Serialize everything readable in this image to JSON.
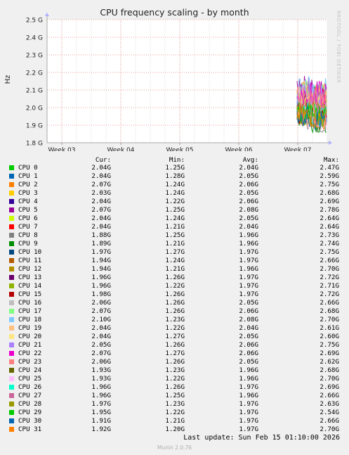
{
  "chart_data": {
    "type": "line",
    "title": "CPU frequency scaling - by month",
    "ylabel": "Hz",
    "ylim": [
      1.8,
      2.5
    ],
    "y_ticks": [
      "1.8 G",
      "1.9 G",
      "2.0 G",
      "2.1 G",
      "2.2 G",
      "2.3 G",
      "2.4 G",
      "2.5 G"
    ],
    "x_ticks": [
      "Week 03",
      "Week 04",
      "Week 05",
      "Week 06",
      "Week 07"
    ],
    "grid": true,
    "watermark": "RRDTOOL / TOBI OETIKER",
    "columns": [
      "Cur:",
      "Min:",
      "Avg:",
      "Max:"
    ],
    "series": [
      {
        "name": "CPU 0",
        "color": "#00cc00",
        "cur": "2.04G",
        "min": "1.25G",
        "avg": "2.04G",
        "max": "2.47G"
      },
      {
        "name": "CPU 1",
        "color": "#0066b3",
        "cur": "2.04G",
        "min": "1.28G",
        "avg": "2.05G",
        "max": "2.59G"
      },
      {
        "name": "CPU 2",
        "color": "#ff8000",
        "cur": "2.07G",
        "min": "1.24G",
        "avg": "2.06G",
        "max": "2.75G"
      },
      {
        "name": "CPU 3",
        "color": "#ffcc00",
        "cur": "2.03G",
        "min": "1.24G",
        "avg": "2.05G",
        "max": "2.68G"
      },
      {
        "name": "CPU 4",
        "color": "#330099",
        "cur": "2.04G",
        "min": "1.22G",
        "avg": "2.06G",
        "max": "2.69G"
      },
      {
        "name": "CPU 5",
        "color": "#990099",
        "cur": "2.07G",
        "min": "1.25G",
        "avg": "2.08G",
        "max": "2.78G"
      },
      {
        "name": "CPU 6",
        "color": "#ccff00",
        "cur": "2.04G",
        "min": "1.24G",
        "avg": "2.05G",
        "max": "2.64G"
      },
      {
        "name": "CPU 7",
        "color": "#ff0000",
        "cur": "2.04G",
        "min": "1.21G",
        "avg": "2.04G",
        "max": "2.64G"
      },
      {
        "name": "CPU 8",
        "color": "#808080",
        "cur": "1.88G",
        "min": "1.25G",
        "avg": "1.96G",
        "max": "2.73G"
      },
      {
        "name": "CPU 9",
        "color": "#008f00",
        "cur": "1.89G",
        "min": "1.21G",
        "avg": "1.96G",
        "max": "2.74G"
      },
      {
        "name": "CPU 10",
        "color": "#00487d",
        "cur": "1.97G",
        "min": "1.27G",
        "avg": "1.97G",
        "max": "2.75G"
      },
      {
        "name": "CPU 11",
        "color": "#b35a00",
        "cur": "1.94G",
        "min": "1.24G",
        "avg": "1.97G",
        "max": "2.66G"
      },
      {
        "name": "CPU 12",
        "color": "#b38f00",
        "cur": "1.94G",
        "min": "1.21G",
        "avg": "1.96G",
        "max": "2.70G"
      },
      {
        "name": "CPU 13",
        "color": "#6b006b",
        "cur": "1.96G",
        "min": "1.26G",
        "avg": "1.97G",
        "max": "2.72G"
      },
      {
        "name": "CPU 14",
        "color": "#8fb300",
        "cur": "1.96G",
        "min": "1.22G",
        "avg": "1.97G",
        "max": "2.71G"
      },
      {
        "name": "CPU 15",
        "color": "#b30000",
        "cur": "1.98G",
        "min": "1.26G",
        "avg": "1.97G",
        "max": "2.72G"
      },
      {
        "name": "CPU 16",
        "color": "#bebebe",
        "cur": "2.06G",
        "min": "1.26G",
        "avg": "2.05G",
        "max": "2.66G"
      },
      {
        "name": "CPU 17",
        "color": "#80ff80",
        "cur": "2.07G",
        "min": "1.26G",
        "avg": "2.06G",
        "max": "2.68G"
      },
      {
        "name": "CPU 18",
        "color": "#80c9ff",
        "cur": "2.10G",
        "min": "1.23G",
        "avg": "2.08G",
        "max": "2.70G"
      },
      {
        "name": "CPU 19",
        "color": "#ffc080",
        "cur": "2.04G",
        "min": "1.22G",
        "avg": "2.04G",
        "max": "2.61G"
      },
      {
        "name": "CPU 20",
        "color": "#ffe680",
        "cur": "2.04G",
        "min": "1.27G",
        "avg": "2.05G",
        "max": "2.60G"
      },
      {
        "name": "CPU 21",
        "color": "#aa80ff",
        "cur": "2.05G",
        "min": "1.26G",
        "avg": "2.06G",
        "max": "2.75G"
      },
      {
        "name": "CPU 22",
        "color": "#ee00cc",
        "cur": "2.07G",
        "min": "1.27G",
        "avg": "2.06G",
        "max": "2.69G"
      },
      {
        "name": "CPU 23",
        "color": "#ff8080",
        "cur": "2.06G",
        "min": "1.26G",
        "avg": "2.05G",
        "max": "2.62G"
      },
      {
        "name": "CPU 24",
        "color": "#666600",
        "cur": "1.93G",
        "min": "1.23G",
        "avg": "1.96G",
        "max": "2.68G"
      },
      {
        "name": "CPU 25",
        "color": "#ffbfff",
        "cur": "1.93G",
        "min": "1.22G",
        "avg": "1.96G",
        "max": "2.70G"
      },
      {
        "name": "CPU 26",
        "color": "#00ffcc",
        "cur": "1.96G",
        "min": "1.26G",
        "avg": "1.97G",
        "max": "2.69G"
      },
      {
        "name": "CPU 27",
        "color": "#cc6699",
        "cur": "1.96G",
        "min": "1.25G",
        "avg": "1.96G",
        "max": "2.66G"
      },
      {
        "name": "CPU 28",
        "color": "#999900",
        "cur": "1.97G",
        "min": "1.23G",
        "avg": "1.97G",
        "max": "2.63G"
      },
      {
        "name": "CPU 29",
        "color": "#00cc00",
        "cur": "1.95G",
        "min": "1.22G",
        "avg": "1.97G",
        "max": "2.54G"
      },
      {
        "name": "CPU 30",
        "color": "#0066b3",
        "cur": "1.91G",
        "min": "1.21G",
        "avg": "1.97G",
        "max": "2.66G"
      },
      {
        "name": "CPU 31",
        "color": "#ff8000",
        "cur": "1.92G",
        "min": "1.20G",
        "avg": "1.97G",
        "max": "2.70G"
      }
    ]
  },
  "footer": {
    "last_update": "Last update: Sun Feb 15 01:10:00 2026",
    "munin": "Munin 2.0.76"
  }
}
